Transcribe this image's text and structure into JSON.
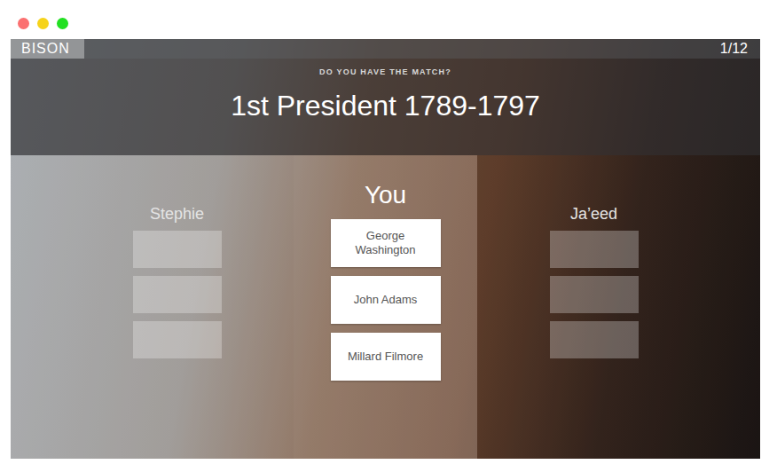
{
  "window_controls": [
    {
      "color": "#fb7070"
    },
    {
      "color": "#f6d31a"
    },
    {
      "color": "#22e022"
    }
  ],
  "app": {
    "title": "BISON",
    "progress": "1/12"
  },
  "question": {
    "prompt": "DO YOU HAVE THE MATCH?",
    "text": "1st President 1789-1797"
  },
  "players": [
    {
      "name": "Stephie",
      "kind": "opponent",
      "cards": [
        {
          "revealed": false
        },
        {
          "revealed": false
        },
        {
          "revealed": false
        }
      ]
    },
    {
      "name": "You",
      "kind": "self",
      "cards": [
        {
          "revealed": true,
          "text": "George Washington"
        },
        {
          "revealed": true,
          "text": "John Adams"
        },
        {
          "revealed": true,
          "text": "Millard Filmore"
        }
      ]
    },
    {
      "name": "Ja’eed",
      "kind": "opponent",
      "cards": [
        {
          "revealed": false
        },
        {
          "revealed": false
        },
        {
          "revealed": false
        }
      ]
    }
  ]
}
